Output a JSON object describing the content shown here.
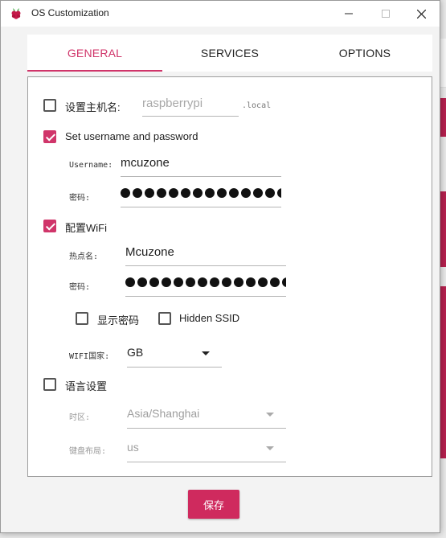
{
  "window": {
    "title": "OS Customization",
    "minimize_icon": "minimize-icon",
    "maximize_icon": "maximize-icon",
    "close_icon": "close-icon",
    "app_icon": "raspberry-icon"
  },
  "tabs": [
    {
      "label": "GENERAL",
      "active": true
    },
    {
      "label": "SERVICES",
      "active": false
    },
    {
      "label": "OPTIONS",
      "active": false
    }
  ],
  "colors": {
    "accent": "#d0356a",
    "button": "#cf2a5e"
  },
  "general": {
    "hostname": {
      "label": "设置主机名:",
      "checked": false,
      "placeholder": "raspberrypi",
      "suffix": ".local"
    },
    "user": {
      "label": "Set username and password",
      "checked": true,
      "username_label": "Username:",
      "username_value": "mcuzone",
      "password_label": "密码:",
      "password_dots": 14
    },
    "wifi": {
      "label": "配置WiFi",
      "checked": true,
      "ssid_label": "热点名:",
      "ssid_value": "Mcuzone",
      "password_label": "密码:",
      "password_dots": 14,
      "show_password_label": "显示密码",
      "show_password_checked": false,
      "hidden_ssid_label": "Hidden SSID",
      "hidden_ssid_checked": false,
      "country_label": "WIFI国家:",
      "country_value": "GB"
    },
    "locale": {
      "label": "语言设置",
      "checked": false,
      "timezone_label": "时区:",
      "timezone_value": "Asia/Shanghai",
      "keyboard_label": "键盘布局:",
      "keyboard_value": "us"
    }
  },
  "footer": {
    "save_label": "保存"
  }
}
